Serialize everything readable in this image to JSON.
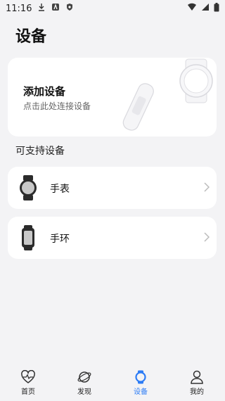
{
  "status_bar": {
    "time": "11:16"
  },
  "page": {
    "title": "设备"
  },
  "add_device": {
    "title": "添加设备",
    "subtitle": "点击此处连接设备"
  },
  "supported": {
    "title": "可支持设备",
    "items": [
      {
        "label": "手表",
        "icon": "watch-icon"
      },
      {
        "label": "手环",
        "icon": "band-icon"
      }
    ]
  },
  "tabbar": {
    "items": [
      {
        "label": "首页",
        "icon": "heart-pulse-icon"
      },
      {
        "label": "发现",
        "icon": "planet-icon"
      },
      {
        "label": "设备",
        "icon": "watch-ring-icon",
        "active": true
      },
      {
        "label": "我的",
        "icon": "person-icon"
      }
    ]
  },
  "colors": {
    "accent": "#2d7cf5",
    "background": "#f3f3f5",
    "card": "#ffffff"
  }
}
